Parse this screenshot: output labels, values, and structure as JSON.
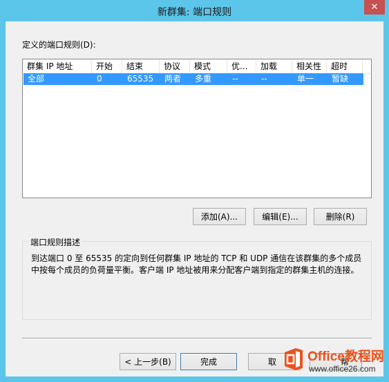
{
  "window": {
    "title": "新群集: 端口规则",
    "close_label": "✕"
  },
  "rules": {
    "label": "定义的端口规则(D):",
    "columns": [
      "群集 IP 地址",
      "开始",
      "结束",
      "协议",
      "模式",
      "优...",
      "加载",
      "相关性",
      "超时"
    ],
    "rows": [
      [
        "全部",
        "0",
        "65535",
        "两者",
        "多重",
        "--",
        "--",
        "单一",
        "暂缺"
      ]
    ]
  },
  "actions": {
    "add": "添加(A)...",
    "edit": "编辑(E)...",
    "delete": "删除(R)"
  },
  "description": {
    "group_label": "端口规则描述",
    "text": "到达端口 0 至 65535 的定向到任何群集 IP 地址的 TCP 和 UDP 通信在该群集的多个成员中按每个成员的负荷量平衡。客户端 IP 地址被用来分配客户端到指定的群集主机的连接。"
  },
  "footer": {
    "back": "< 上一步(B)",
    "finish": "完成",
    "cancel": "取",
    "help": "帮"
  },
  "watermark": {
    "brand": "Office教程网",
    "url": "www.office26.com"
  },
  "colors": {
    "title_bar": "#5cc5ea",
    "selection": "#3399ff",
    "close_button": "#c75050",
    "watermark_accent": "#e8531d"
  }
}
